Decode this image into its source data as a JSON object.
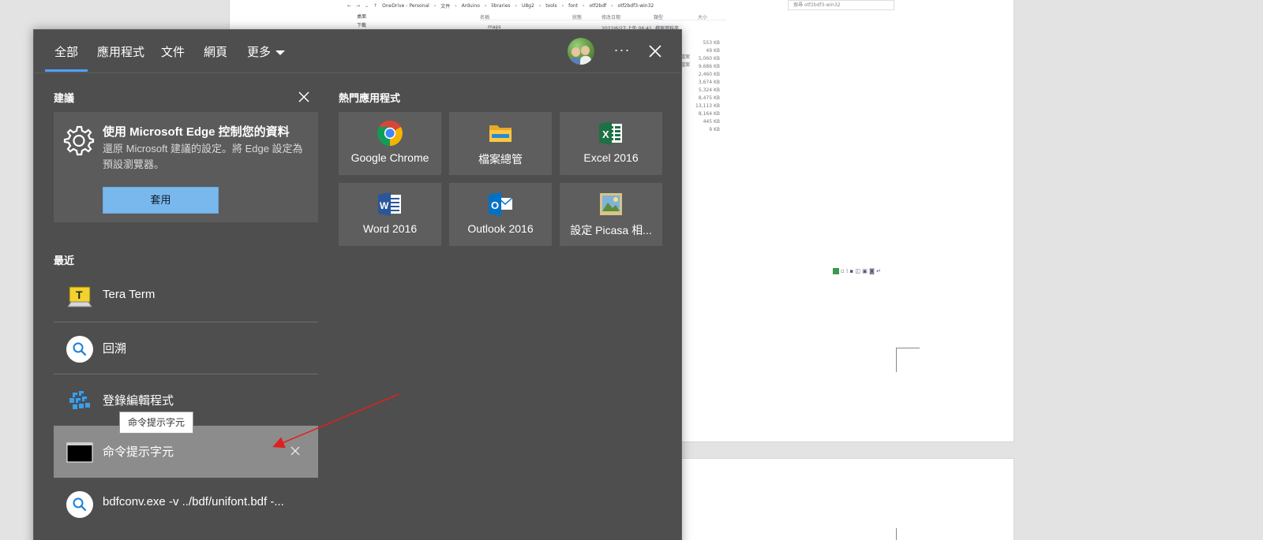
{
  "background": {
    "explorer": {
      "breadcrumb": [
        "OneDrive - Personal",
        "文件",
        "Arduino",
        "libraries",
        "U8g2",
        "tools",
        "font",
        "otf2bdf",
        "otf2bdf3-win32"
      ],
      "search_placeholder": "搜尋 otf2bdf3-win32",
      "left_items": [
        "桌面",
        "下載"
      ],
      "headers": [
        "名稱",
        "狀態",
        "修改日期",
        "類型",
        "大小"
      ],
      "first_row": {
        "name": "maps",
        "date": "2022/6/27 上午 06:41",
        "type": "檔案資料夾"
      },
      "sizes": [
        "553 KB",
        "49 KB",
        "5,060 KB",
        "9,686 KB",
        "2,460 KB",
        "3,674 KB",
        "5,324 KB",
        "8,475 KB",
        "13,113 KB",
        "8,164 KB",
        "445 KB",
        "9 KB"
      ],
      "types": [
        "檔案",
        "檔案"
      ]
    }
  },
  "menu": {
    "tabs": [
      "全部",
      "應用程式",
      "文件",
      "網頁",
      "更多"
    ],
    "active_tab": "全部",
    "more_label": "···",
    "accent": "#4da3ff",
    "suggestions": {
      "title": "建議",
      "card_title": "使用 Microsoft Edge 控制您的資料",
      "card_desc": "還原 Microsoft 建議的設定。將 Edge 設定為預設瀏覽器。",
      "apply_label": "套用",
      "apply_color": "#79b8ec"
    },
    "top_apps": {
      "title": "熱門應用程式",
      "items": [
        {
          "label": "Google Chrome",
          "icon": "chrome-icon"
        },
        {
          "label": "檔案總管",
          "icon": "file-explorer-icon"
        },
        {
          "label": "Excel 2016",
          "icon": "excel-icon"
        },
        {
          "label": "Word 2016",
          "icon": "word-icon"
        },
        {
          "label": "Outlook 2016",
          "icon": "outlook-icon"
        },
        {
          "label": "設定 Picasa 相...",
          "icon": "picasa-icon"
        }
      ]
    },
    "recent": {
      "title": "最近",
      "items": [
        {
          "label": "Tera Term",
          "icon": "tera-term-icon"
        },
        {
          "label": "回溯",
          "icon": "search-icon"
        },
        {
          "label": "登錄編輯程式",
          "icon": "registry-editor-icon"
        },
        {
          "label": "命令提示字元",
          "icon": "command-prompt-icon"
        },
        {
          "label": "bdfconv.exe -v ../bdf/unifont.bdf -...",
          "icon": "search-icon"
        }
      ],
      "tooltip": "命令提示字元"
    }
  }
}
